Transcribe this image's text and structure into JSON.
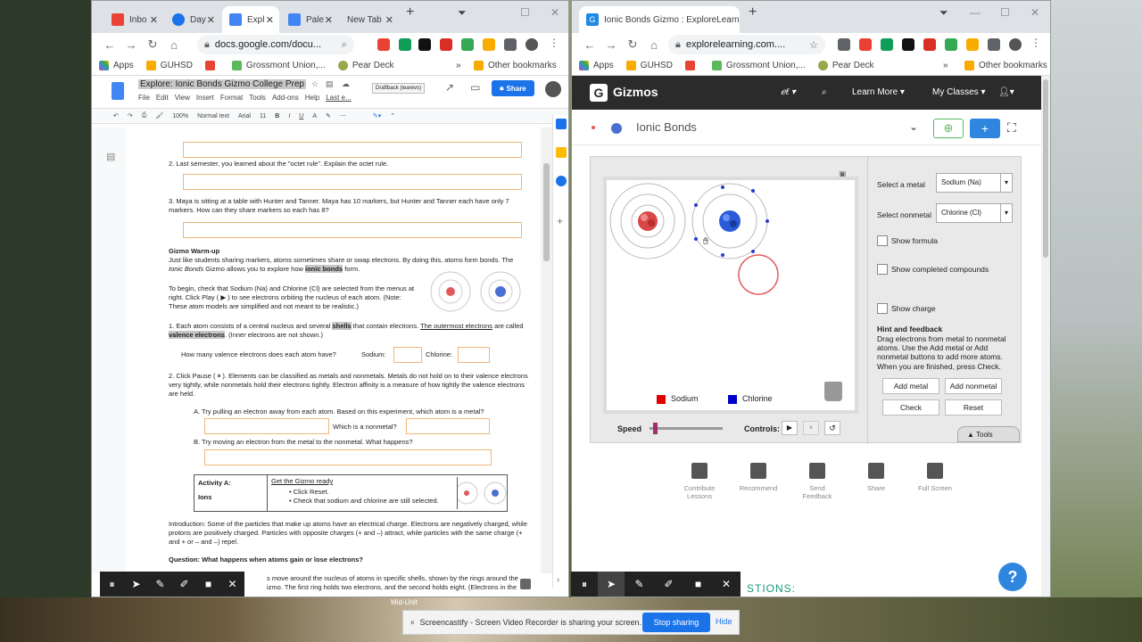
{
  "left_window": {
    "tabs": [
      {
        "label": "Inbo",
        "color": "#ea4335"
      },
      {
        "label": "Day",
        "color": "#1a73e8"
      },
      {
        "label": "Expl",
        "color": "#4285f4"
      },
      {
        "label": "Pale",
        "color": "#4285f4"
      },
      {
        "label": "New Tab",
        "color": "#ffffff"
      }
    ],
    "url": "docs.google.com/docu...",
    "bookmarks": [
      "Apps",
      "GUHSD",
      "Grossmont Union,...",
      "Pear Deck",
      "Other bookmarks"
    ],
    "doc_title": "Explore: Ionic Bonds Gizmo College Prep",
    "menus": [
      "File",
      "Edit",
      "View",
      "Insert",
      "Format",
      "Tools",
      "Add-ons",
      "Help",
      "Last e..."
    ],
    "draftback": "Draftback (tearevs)",
    "share_label": "Share",
    "toolbar": {
      "zoom": "100%",
      "style": "Normal text",
      "font": "Arial",
      "size": "11"
    },
    "content": {
      "q2": "2.   Last semester, you learned about the \"octet rule\". Explain the octet rule.",
      "q3": "3.   Maya is sitting at a table with Hunter and Tanner. Maya has 10 markers, but Hunter and Tanner each have only 7 markers. How can they share markers so each has 8?",
      "warmup_title": "Gizmo Warm-up",
      "warmup_p1a": "Just like students sharing markers, atoms sometimes share or swap electrons. By doing this, atoms form bonds. The ",
      "warmup_p1b": "Ionic Bonds",
      "warmup_p1c": " Gizmo allows you to explore how ",
      "warmup_p1d": "ionic bonds",
      "warmup_p1e": " form.",
      "warmup_p2": "To begin, check that Sodium (Na) and Chlorine (Cl) are selected from the menus at right. Click Play ( ▶ ) to see electrons orbiting the nucleus of each atom. (Note: These atom models are simplified and not meant to be realistic.)",
      "item1a": "1.   Each atom consists of a central nucleus and several ",
      "item1b": "shells",
      "item1c": " that contain electrons. ",
      "item1d": "The outermost electrons",
      "item1e": " are called ",
      "item1f": "valence electrons",
      "item1g": ". (Inner electrons are not shown.)",
      "valence_q": "How many valence electrons does each atom have?",
      "sodium_label": "Sodium:",
      "chlorine_label": "Chlorine:",
      "item2": "2.   Click Pause ( ⏸ ). Elements can be classified as metals and nonmetals. Metals do not hold on to their valence electrons very tightly, while nonmetals hold their electrons tightly. Electron affinity is a measure of how tightly the valence electrons are held.",
      "itemA": "A.   Try pulling an electron away from each atom. Based on this experiment, which atom is a metal?",
      "nonmetal_q": "Which is a nonmetal?",
      "itemB": "B.   Try moving an electron from the metal to the nonmetal. What happens?",
      "activity_label": "Activity A:",
      "activity_name": "Ions",
      "activity_ready": "Get the Gizmo ready",
      "activity_b1": "Click Reset.",
      "activity_b2": "Check that sodium and chlorine are still selected.",
      "intro": "Introduction: Some of the particles that make up atoms have an electrical charge. Electrons are negatively charged, while protons are positively charged. Particles with opposite charges (+ and –) attract, while particles with the same charge (+ and + or – and –) repel.",
      "question": "Question: What happens when atoms gain or lose electrons?",
      "trailing": "s move around the nucleus of atoms in specific shells, shown by the rings around the izmo. The first ring holds two electrons, and the second holds eight. (Electrons in the"
    }
  },
  "right_window": {
    "tab_label": "Ionic Bonds Gizmo : ExploreLearn",
    "url": "explorelearning.com....",
    "bookmarks": [
      "Apps",
      "GUHSD",
      "Grossmont Union,...",
      "Pear Deck",
      "Other bookmarks"
    ],
    "brand": "Gizmos",
    "nav": [
      "Learn More ▾",
      "My Classes ▾"
    ],
    "title": "Ionic Bonds",
    "select_metal_label": "Select a metal",
    "select_metal_value": "Sodium (Na)",
    "select_nonmetal_label": "Select nonmetal",
    "select_nonmetal_value": "Chlorine (Cl)",
    "checkboxes": [
      "Show formula",
      "Show completed compounds",
      "Show charge"
    ],
    "hint_title": "Hint and feedback",
    "hint_text": "Drag electrons from metal to nonmetal atoms. Use the Add metal or Add nonmetal buttons to add more atoms. When you are finished, press Check.",
    "buttons": {
      "add_metal": "Add metal",
      "add_nonmetal": "Add nonmetal",
      "check": "Check",
      "reset": "Reset"
    },
    "legend": [
      {
        "label": "Sodium",
        "color": "#e00000"
      },
      {
        "label": "Chlorine",
        "color": "#0000cc"
      }
    ],
    "speed_label": "Speed",
    "controls_label": "Controls:",
    "tools_label": "Tools",
    "actions": [
      "Contribute Lessons",
      "Recommend",
      "Send Feedback",
      "Share",
      "Full Screen"
    ],
    "bottom_text": "STIONS:"
  },
  "screencastify": {
    "message": "Screencastify - Screen Video Recorder is sharing your screen.",
    "stop": "Stop sharing",
    "hide": "Hide"
  },
  "taskbar_text": "Mid-Unit"
}
